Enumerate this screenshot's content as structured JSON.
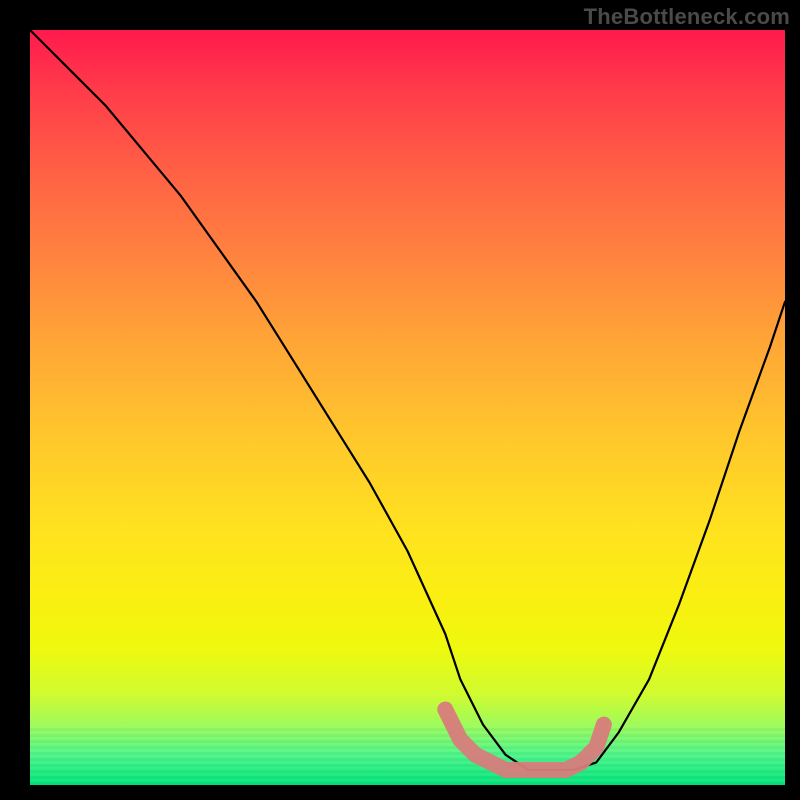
{
  "watermark": "TheBottleneck.com",
  "chart_data": {
    "type": "line",
    "title": "",
    "xlabel": "",
    "ylabel": "",
    "xlim": [
      0,
      100
    ],
    "ylim": [
      0,
      100
    ],
    "grid": false,
    "series": [
      {
        "name": "bottleneck-curve",
        "color": "#000000",
        "x": [
          0,
          5,
          10,
          15,
          20,
          25,
          30,
          35,
          40,
          45,
          50,
          55,
          57,
          60,
          63,
          66,
          69,
          72,
          75,
          78,
          82,
          86,
          90,
          94,
          98,
          100
        ],
        "values": [
          100,
          95,
          90,
          84,
          78,
          71,
          64,
          56,
          48,
          40,
          31,
          20,
          14,
          8,
          4,
          2,
          2,
          2,
          3,
          7,
          14,
          24,
          35,
          47,
          58,
          64
        ]
      },
      {
        "name": "valley-highlight",
        "color": "#d87c7c",
        "x": [
          55,
          57,
          59,
          61,
          63,
          65,
          67,
          69,
          71,
          73,
          75,
          76
        ],
        "values": [
          10,
          6,
          4,
          3,
          2,
          2,
          2,
          2,
          2,
          3,
          5,
          8
        ]
      }
    ],
    "background_gradient": {
      "top": "#ff1a4d",
      "mid": "#ffe21f",
      "bottom": "#00e47a"
    }
  }
}
